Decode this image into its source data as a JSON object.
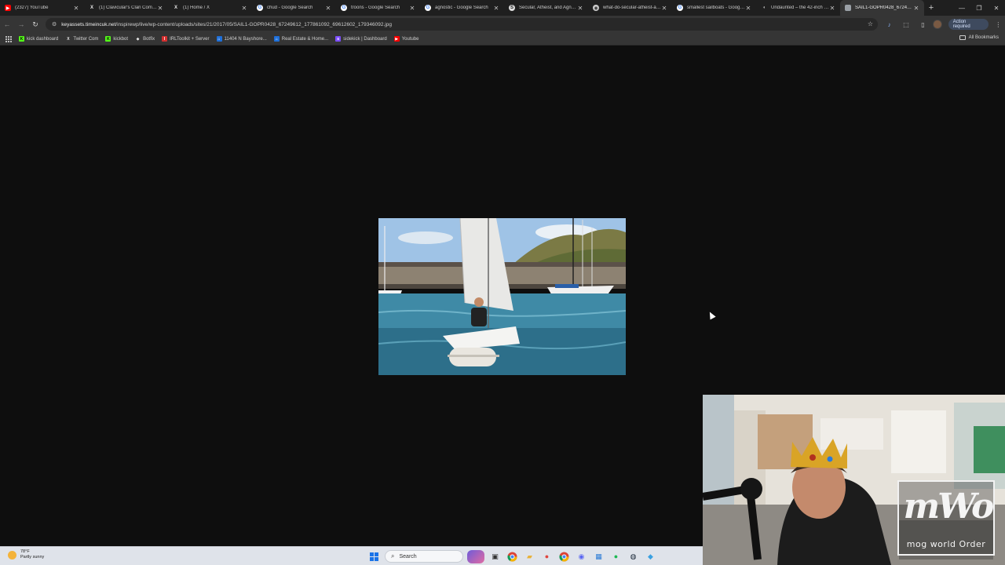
{
  "browser": {
    "tabs": [
      {
        "title": "(2327) YouTube",
        "icon": "youtube-icon",
        "color": "#ff0000",
        "glyph": "▶",
        "active": false
      },
      {
        "title": "(1) Clavicular's Clan Community",
        "icon": "x-icon",
        "color": "#000000",
        "glyph": "X",
        "active": false
      },
      {
        "title": "(1) Home / X",
        "icon": "x-icon",
        "color": "#000000",
        "glyph": "X",
        "active": false
      },
      {
        "title": "chud - Google Search",
        "icon": "google-icon",
        "color": "#ffffff",
        "glyph": "G",
        "active": false
      },
      {
        "title": "troons - Google Search",
        "icon": "google-icon",
        "color": "#ffffff",
        "glyph": "G",
        "active": false
      },
      {
        "title": "agnostic - Google Search",
        "icon": "google-icon",
        "color": "#ffffff",
        "glyph": "G",
        "active": false
      },
      {
        "title": "Secular, Atheist, and Agnostic",
        "icon": "site-icon",
        "color": "#dddddd",
        "glyph": "S",
        "active": false
      },
      {
        "title": "what-do-secular-atheist-and-agnostic",
        "icon": "globe-icon",
        "color": "#cfcfcf",
        "glyph": "◉",
        "active": false
      },
      {
        "title": "smallest sailboats - Google Search",
        "icon": "google-icon",
        "color": "#ffffff",
        "glyph": "G",
        "active": false
      },
      {
        "title": "Undaunted – the 42-inch sailboat",
        "icon": "site-icon",
        "color": "#b0b0b0",
        "glyph": "◖",
        "active": false
      },
      {
        "title": "SAIL1-GOPR0428_67249612",
        "icon": "page-icon",
        "color": "#9aa0a6",
        "glyph": "·",
        "active": true
      }
    ],
    "url_host": "keyassets.timeincuk.net",
    "url_path": "/inspirewp/live/wp-content/uploads/sites/21/2017/05/SAIL1-GOPR0428_67249612_177861092_69612602_179346092.jpg",
    "action_required": "Action required",
    "bookmarks": [
      {
        "label": "kick dashboard",
        "icon": "kick-icon",
        "color": "#53fc18",
        "glyph": "K"
      },
      {
        "label": "Twitter Com",
        "icon": "x-icon",
        "color": "#000000",
        "glyph": "X"
      },
      {
        "label": "kickbot",
        "icon": "kick-icon",
        "color": "#53fc18",
        "glyph": "K"
      },
      {
        "label": "Botfix",
        "icon": "bot-icon",
        "color": "#444444",
        "glyph": "◆"
      },
      {
        "label": "IRLToolkit + Server",
        "icon": "irl-icon",
        "color": "#d32f2f",
        "glyph": "I"
      },
      {
        "label": "11404 N Bayshore...",
        "icon": "home-icon",
        "color": "#1e6fd9",
        "glyph": "⌂"
      },
      {
        "label": "Real Estate & Home...",
        "icon": "home-icon",
        "color": "#1e6fd9",
        "glyph": "⌂"
      },
      {
        "label": "sidekick | Dashboard",
        "icon": "sidekick-icon",
        "color": "#7c4dff",
        "glyph": "s"
      },
      {
        "label": "Youtube",
        "icon": "youtube-icon",
        "color": "#ff0000",
        "glyph": "▶"
      }
    ],
    "all_bookmarks": "All Bookmarks"
  },
  "overlay": {
    "logo_main": "mWo",
    "logo_sub": "mog world Order"
  },
  "taskbar": {
    "temperature": "78°F",
    "weather": "Partly sunny",
    "search_placeholder": "Search"
  }
}
